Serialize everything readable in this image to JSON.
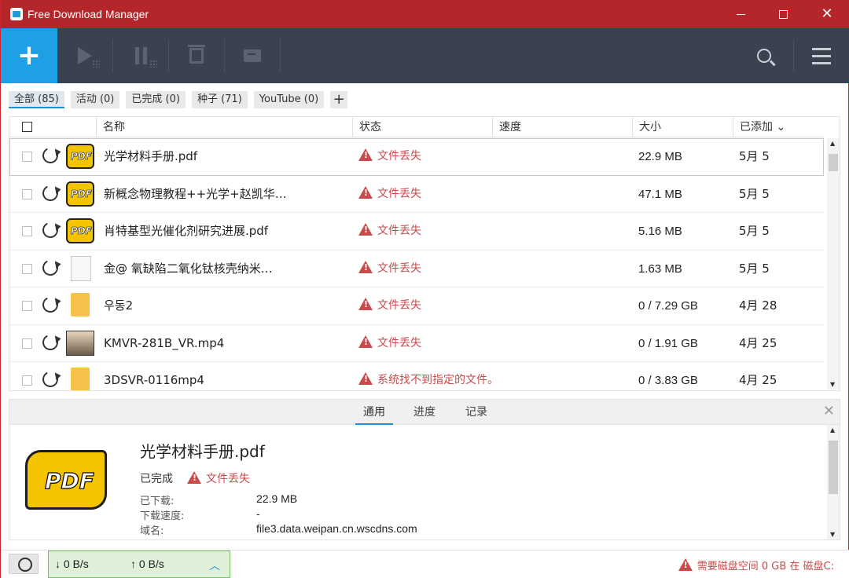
{
  "window": {
    "title": "Free Download Manager"
  },
  "filters": [
    {
      "label": "全部 (85)"
    },
    {
      "label": "活动 (0)"
    },
    {
      "label": "已完成 (0)"
    },
    {
      "label": "种子 (71)"
    },
    {
      "label": "YouTube (0)"
    }
  ],
  "columns": {
    "name": "名称",
    "status": "状态",
    "speed": "速度",
    "size": "大小",
    "added": "已添加 ⌄"
  },
  "rows": [
    {
      "name": "光学材料手册.pdf",
      "status": "文件丢失",
      "size": "22.9 MB",
      "added": "5月 5",
      "icon": "pdf-icon"
    },
    {
      "name": "新概念物理教程++光学+赵凯华…",
      "status": "文件丢失",
      "size": "47.1 MB",
      "added": "5月 5",
      "icon": "pdf-icon"
    },
    {
      "name": "肖特基型光催化剂研究进展.pdf",
      "status": "文件丢失",
      "size": "5.16 MB",
      "added": "5月 5",
      "icon": "pdf-icon"
    },
    {
      "name": "金@ 氧缺陷二氧化钛核壳纳米…",
      "status": "文件丢失",
      "size": "1.63 MB",
      "added": "5月 5",
      "icon": "document-icon"
    },
    {
      "name": "우동2",
      "status": "文件丢失",
      "size": "0 / 7.29 GB",
      "added": "4月 28",
      "icon": "folder-icon"
    },
    {
      "name": "KMVR-281B_VR.mp4",
      "status": "文件丢失",
      "size": "0 / 1.91 GB",
      "added": "4月 25",
      "icon": "video-thumbnail-icon"
    },
    {
      "name": "3DSVR-0116mp4",
      "status": "系统找不到指定的文件。",
      "size": "0 / 3.83 GB",
      "added": "4月 25",
      "icon": "folder-icon"
    }
  ],
  "detail": {
    "tabs": [
      "通用",
      "进度",
      "记录"
    ],
    "title": "光学材料手册.pdf",
    "state": "已完成",
    "status": "文件丢失",
    "downloaded_label": "已下载:",
    "downloaded_value": "22.9 MB",
    "speed_label": "下载速度:",
    "speed_value": "-",
    "domain_label": "域名:",
    "domain_value": "file3.data.weipan.cn.wscdns.com"
  },
  "statusbar": {
    "down": "↓  0 B/s",
    "up": "↑  0 B/s",
    "disk": "需要磁盘空间 0 GB 在 磁盘C:"
  },
  "colors": {
    "titlebar": "#b5262b",
    "toolbar": "#3a4250",
    "accent": "#1ea0e6",
    "error": "#c84b4b"
  }
}
